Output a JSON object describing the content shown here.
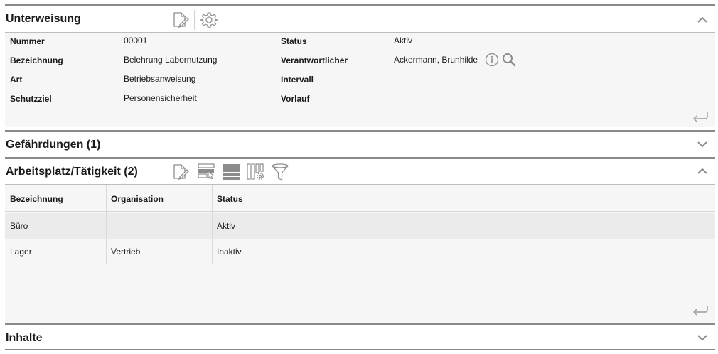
{
  "unterweisung": {
    "title": "Unterweisung",
    "fields": {
      "nummer_label": "Nummer",
      "nummer_value": "00001",
      "bezeichnung_label": "Bezeichnung",
      "bezeichnung_value": "Belehrung Labornutzung",
      "art_label": "Art",
      "art_value": "Betriebsanweisung",
      "schutzziel_label": "Schutzziel",
      "schutzziel_value": "Personensicherheit",
      "status_label": "Status",
      "status_value": "Aktiv",
      "verantwortlicher_label": "Verantwortlicher",
      "verantwortlicher_value": "Ackermann, Brunhilde",
      "intervall_label": "Intervall",
      "vorlauf_label": "Vorlauf"
    },
    "icons": [
      "edit-icon",
      "settings-icon",
      "info-icon",
      "search-icon",
      "return-icon",
      "chevron-up-icon"
    ]
  },
  "gefaehrdungen": {
    "title": "Gefährdungen (1)",
    "icons": [
      "chevron-down-icon"
    ]
  },
  "arbeitsplatz": {
    "title": "Arbeitsplatz/Tätigkeit (2)",
    "icons": [
      "edit-icon",
      "select-rows-icon",
      "list-view-icon",
      "column-settings-icon",
      "filter-icon",
      "chevron-up-icon",
      "return-icon"
    ],
    "columns": [
      "Bezeichnung",
      "Organisation",
      "Status"
    ],
    "rows": [
      {
        "bezeichnung": "Büro",
        "organisation": "",
        "status": "Aktiv"
      },
      {
        "bezeichnung": "Lager",
        "organisation": "Vertrieb",
        "status": "Inaktiv"
      }
    ]
  },
  "inhalte": {
    "title": "Inhalte",
    "icons": [
      "chevron-down-icon"
    ]
  },
  "colors": {
    "header_border": "#8a8a8a",
    "panel_bg": "#f6f6f6",
    "selected_row_bg": "#ebebeb",
    "icon_gray": "#8c8c8c"
  }
}
